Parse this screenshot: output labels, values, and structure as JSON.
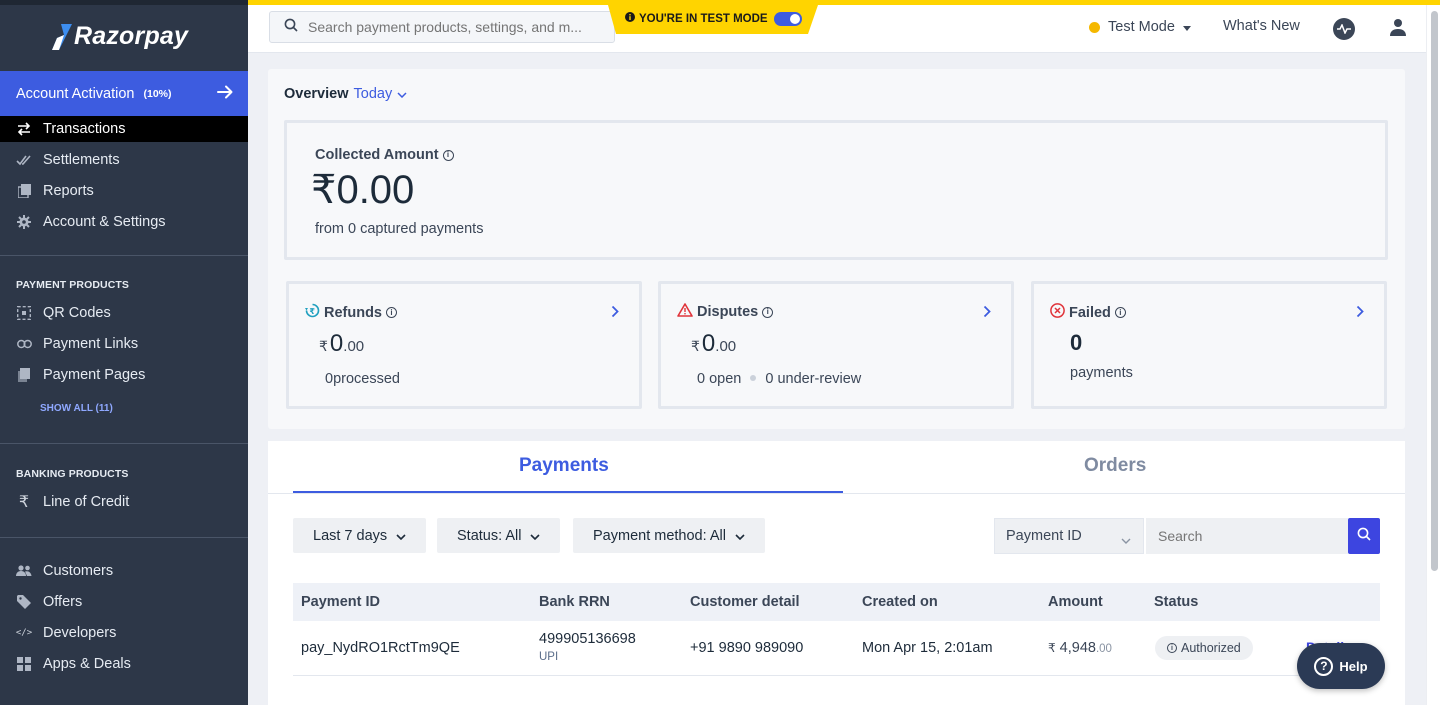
{
  "brand": {
    "name": "Razorpay",
    "accent": "#3d5ce0"
  },
  "sidebar": {
    "activation": {
      "label": "Account Activation",
      "percent": "(10%)"
    },
    "main_items": [
      {
        "label": "Transactions",
        "icon": "swap-arrows-icon",
        "active": true
      },
      {
        "label": "Settlements",
        "icon": "double-check-icon"
      },
      {
        "label": "Reports",
        "icon": "reports-icon"
      },
      {
        "label": "Account & Settings",
        "icon": "gear-icon"
      }
    ],
    "payment_products": {
      "heading": "PAYMENT PRODUCTS",
      "items": [
        {
          "label": "QR Codes",
          "icon": "qr-code-icon"
        },
        {
          "label": "Payment Links",
          "icon": "link-icon"
        },
        {
          "label": "Payment Pages",
          "icon": "page-icon"
        }
      ],
      "show_all": "SHOW ALL (11)"
    },
    "banking_products": {
      "heading": "BANKING PRODUCTS",
      "items": [
        {
          "label": "Line of Credit",
          "icon": "rupee-icon"
        }
      ]
    },
    "bottom_items": [
      {
        "label": "Customers",
        "icon": "users-icon"
      },
      {
        "label": "Offers",
        "icon": "tag-icon"
      },
      {
        "label": "Developers",
        "icon": "code-icon"
      },
      {
        "label": "Apps & Deals",
        "icon": "apps-grid-icon"
      }
    ]
  },
  "topbar": {
    "search_placeholder": "Search payment products, settings, and m...",
    "test_mode_banner": "YOU'RE IN TEST MODE",
    "mode_dropdown": "Test Mode",
    "whats_new": "What's New"
  },
  "overview": {
    "title": "Overview",
    "period": "Today",
    "collected": {
      "label": "Collected Amount",
      "amount": "₹0.00",
      "sub": "from 0 captured payments"
    },
    "refunds": {
      "label": "Refunds",
      "currency": "₹",
      "whole": "0",
      "decimal": ".00",
      "sub": "0processed"
    },
    "disputes": {
      "label": "Disputes",
      "currency": "₹",
      "whole": "0",
      "decimal": ".00",
      "open": "0 open",
      "review": "0 under-review"
    },
    "failed": {
      "label": "Failed",
      "count": "0",
      "sub": "payments"
    }
  },
  "payments": {
    "tabs": [
      {
        "label": "Payments"
      },
      {
        "label": "Orders"
      }
    ],
    "filters": [
      "Last 7 days",
      "Status: All",
      "Payment method: All"
    ],
    "search_field": "Payment ID",
    "search_placeholder": "Search",
    "columns": [
      "Payment ID",
      "Bank RRN",
      "Customer detail",
      "Created on",
      "Amount",
      "Status"
    ],
    "rows": [
      {
        "payment_id": "pay_NydRO1RctTm9QE",
        "bank_rrn": "499905136698",
        "method": "UPI",
        "customer": "+91 9890 989090",
        "created": "Mon Apr 15, 2:01am",
        "amount_currency": "₹",
        "amount_whole": "4,948",
        "amount_decimal": ".00",
        "status": "Authorized",
        "details": "Details"
      }
    ]
  },
  "help": {
    "label": "Help"
  }
}
